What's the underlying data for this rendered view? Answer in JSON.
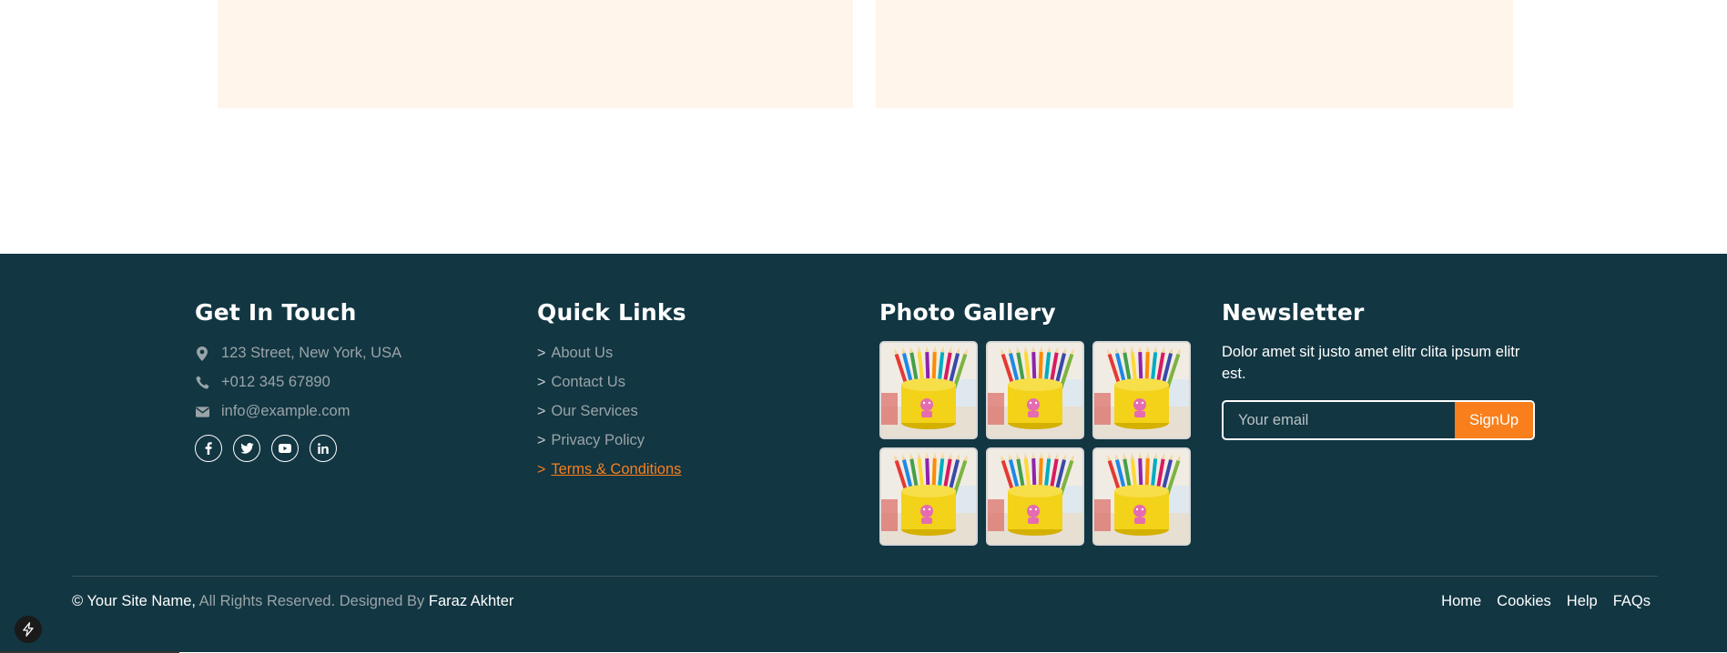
{
  "footer": {
    "contact": {
      "title": "Get In Touch",
      "address": "123 Street, New York, USA",
      "phone": "+012 345 67890",
      "email": "info@example.com",
      "social_icons": [
        "facebook-icon",
        "twitter-icon",
        "youtube-icon",
        "linkedin-icon"
      ]
    },
    "quick_links": {
      "title": "Quick Links",
      "chevron": ">",
      "items": [
        "About Us",
        "Contact Us",
        "Our Services",
        "Privacy Policy",
        "Terms & Conditions"
      ],
      "active_index": 4
    },
    "gallery": {
      "title": "Photo Gallery",
      "count": 6,
      "image_subject": "yellow-pencil-cup"
    },
    "newsletter": {
      "title": "Newsletter",
      "text": "Dolor amet sit justo amet elitr clita ipsum elitr est.",
      "placeholder": "Your email",
      "button": "SignUp"
    },
    "copyright": {
      "site": "© Your Site Name,",
      "rights": "All Rights Reserved. Designed By",
      "author": "Faraz Akhter"
    },
    "bottom_nav": [
      "Home",
      "Cookies",
      "Help",
      "FAQs"
    ]
  },
  "colors": {
    "footer_bg": "#123642",
    "accent": "#f97f1c",
    "card_bg": "#fff5eb",
    "muted_text": "#9aa4a8"
  }
}
